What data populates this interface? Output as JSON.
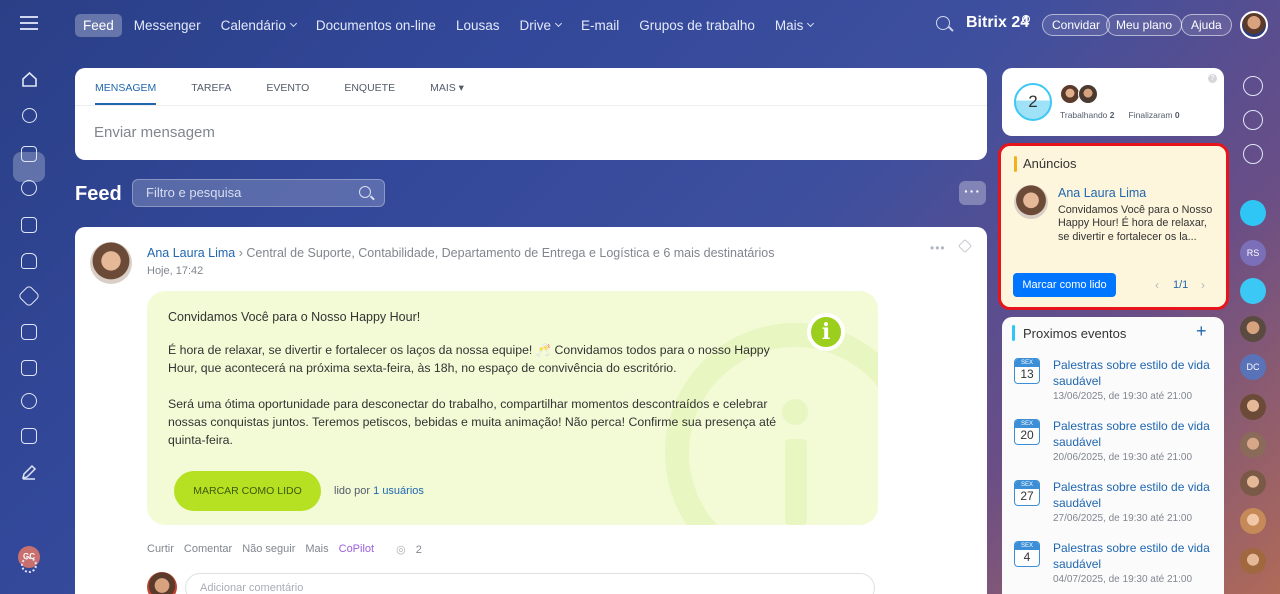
{
  "topbar": {
    "nav": [
      {
        "label": "Feed",
        "active": true,
        "chevron": false
      },
      {
        "label": "Messenger",
        "active": false,
        "chevron": false
      },
      {
        "label": "Calendário",
        "active": false,
        "chevron": true
      },
      {
        "label": "Documentos on-line",
        "active": false,
        "chevron": false
      },
      {
        "label": "Lousas",
        "active": false,
        "chevron": false
      },
      {
        "label": "Drive",
        "active": false,
        "chevron": true
      },
      {
        "label": "E-mail",
        "active": false,
        "chevron": false
      },
      {
        "label": "Grupos de trabalho",
        "active": false,
        "chevron": false
      },
      {
        "label": "Mais",
        "active": false,
        "chevron": true
      }
    ],
    "brand": "Bitrix 24",
    "invite": "Convidar",
    "plan": "Meu plano",
    "help": "Ajuda"
  },
  "composer": {
    "tabs": [
      "Mensagem",
      "Tarefa",
      "Evento",
      "Enquete",
      "Mais"
    ],
    "placeholder": "Enviar mensagem"
  },
  "feed": {
    "title": "Feed",
    "filter_placeholder": "Filtro e pesquisa"
  },
  "post": {
    "author": "Ana Laura Lima",
    "recipients": "Central de Suporte, Contabilidade, Departamento de Entrega e Logística",
    "more_recipients": "e 6 mais destinatários",
    "time": "Hoje, 17:42",
    "title": "Convidamos Você para o Nosso Happy Hour!",
    "p1": "É hora de relaxar, se divertir e fortalecer os laços da nossa equipe! 🥂 Convidamos todos para o nosso Happy Hour, que acontecerá na próxima sexta-feira, às 18h, no espaço de convivência do escritório.",
    "p2": "Será uma ótima oportunidade para desconectar do trabalho, compartilhar momentos descontraídos e celebrar nossas conquistas juntos. Teremos petiscos, bebidas e muita animação! Não perca! Confirme sua presença até quinta-feira.",
    "mark_read": "MARCAR COMO LIDO",
    "read_by_prefix": "lido por",
    "read_by_link": "1 usuários",
    "actions": [
      "Curtir",
      "Comentar",
      "Não seguir",
      "Mais"
    ],
    "copilot": "CoPilot",
    "views": "2",
    "comment_placeholder": "Adicionar comentário"
  },
  "worktime": {
    "count": "2",
    "working_label": "Trabalhando",
    "working_count": "2",
    "finished_label": "Finalizaram",
    "finished_count": "0"
  },
  "announcements": {
    "title": "Anúncios",
    "author": "Ana Laura Lima",
    "text": "Convidamos Você para o Nosso Happy Hour! É hora de relaxar, se divertir e fortalecer os la...",
    "button": "Marcar como lido",
    "pager": "1/1",
    "highlight_color": "#e8141b"
  },
  "events": {
    "title": "Proximos eventos",
    "items": [
      {
        "month": "SEX",
        "day": "13",
        "title": "Palestras sobre estilo de vida saudável",
        "when": "13/06/2025, de 19:30 até 21:00"
      },
      {
        "month": "SEX",
        "day": "20",
        "title": "Palestras sobre estilo de vida saudável",
        "when": "20/06/2025, de 19:30 até 21:00"
      },
      {
        "month": "SEX",
        "day": "27",
        "title": "Palestras sobre estilo de vida saudável",
        "when": "27/06/2025, de 19:30 até 21:00"
      },
      {
        "month": "SEX",
        "day": "4",
        "title": "Palestras sobre estilo de vida saudável",
        "when": "04/07/2025, de 19:30 até 21:00"
      }
    ]
  },
  "right_rail": {
    "initials_1": "RS",
    "initials_2": "DC"
  },
  "left_rail": {
    "initials": "GC"
  },
  "colors": {
    "accent": "#2067b0",
    "primary_button": "#0075ff",
    "lime_button": "#b6e022"
  }
}
